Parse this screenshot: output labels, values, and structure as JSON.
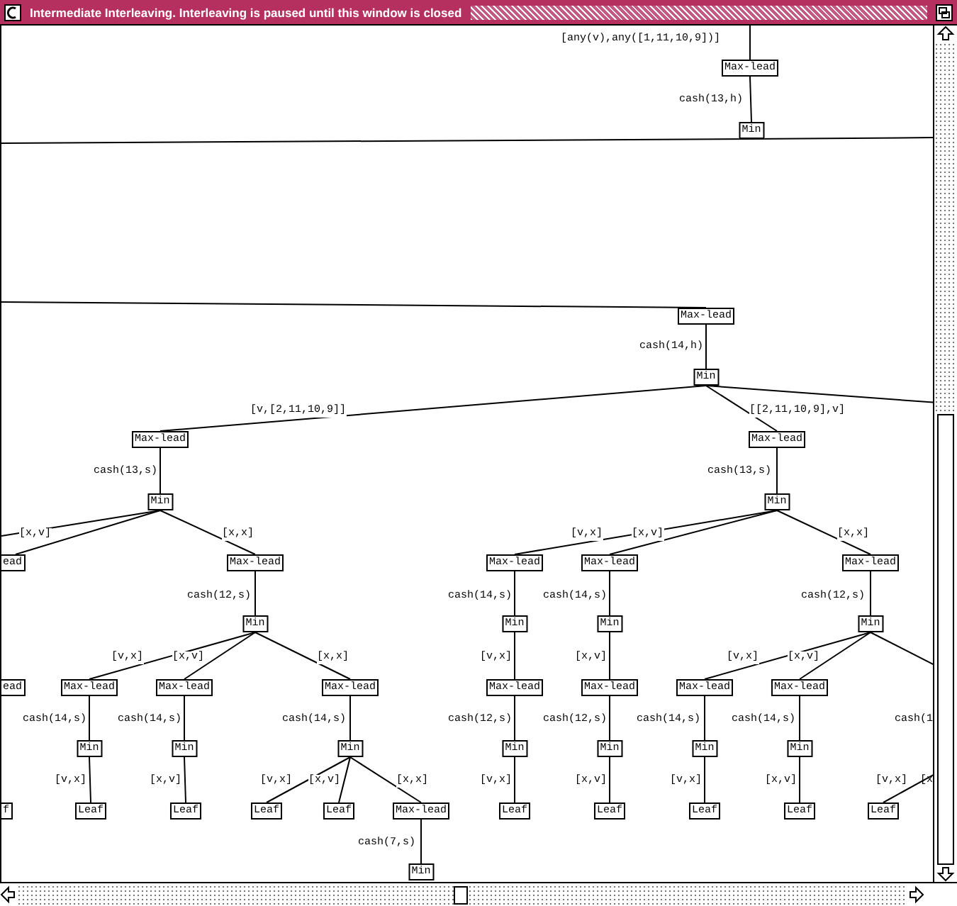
{
  "window": {
    "title": "Intermediate Interleaving. Interleaving is paused until this window is closed"
  },
  "trees": [
    {
      "label": "Max-lead",
      "edge": "[any(v),any([1,11,10,9])]",
      "children": [
        {
          "label": "Min",
          "edge": "cash(13,h)"
        }
      ]
    },
    {
      "label": "Max-lead",
      "children": [
        {
          "label": "Min",
          "edge": "cash(14,h)",
          "children": [
            {
              "label": "Max-lead",
              "edge": "[v,[2,11,10,9]]",
              "children": [
                {
                  "label": "Min",
                  "edge": "cash(13,s)",
                  "children": [
                    {
                      "label": "ead",
                      "edge": "[x,v]"
                    },
                    {
                      "label": "Max-lead",
                      "edge": "[x,x]",
                      "children": [
                        {
                          "label": "Min",
                          "edge": "cash(12,s)",
                          "children": [
                            {
                              "label": "Max-lead",
                              "edge": "[v,x]",
                              "children": [
                                {
                                  "label": "Min",
                                  "edge": "cash(14,s)",
                                  "children": [
                                    {
                                      "label": "Leaf",
                                      "edge": "[v,x]"
                                    }
                                  ]
                                }
                              ]
                            },
                            {
                              "label": "Max-lead",
                              "edge": "[x,v]",
                              "children": [
                                {
                                  "label": "Min",
                                  "edge": "cash(14,s)",
                                  "children": [
                                    {
                                      "label": "Leaf",
                                      "edge": "[x,v]"
                                    }
                                  ]
                                }
                              ]
                            },
                            {
                              "label": "Max-lead",
                              "edge": "[x,x]",
                              "children": [
                                {
                                  "label": "Min",
                                  "edge": "cash(14,s)",
                                  "children": [
                                    {
                                      "label": "Leaf",
                                      "edge": "[v,x]"
                                    },
                                    {
                                      "label": "Leaf",
                                      "edge": "[x,v]"
                                    },
                                    {
                                      "label": "Max-lead",
                                      "edge": "[x,x]",
                                      "children": [
                                        {
                                          "label": "Min",
                                          "edge": "cash(7,s)"
                                        }
                                      ]
                                    }
                                  ]
                                }
                              ]
                            }
                          ]
                        }
                      ]
                    }
                  ]
                }
              ]
            },
            {
              "label": "Max-lead",
              "edge": "[[2,11,10,9],v]",
              "children": [
                {
                  "label": "Min",
                  "edge": "cash(13,s)",
                  "children": [
                    {
                      "label": "Max-lead",
                      "edge": "[v,x]",
                      "children": [
                        {
                          "label": "Min",
                          "edge": "cash(14,s)",
                          "children": [
                            {
                              "label": "Max-lead",
                              "edge": "[v,x]",
                              "children": [
                                {
                                  "label": "Min",
                                  "edge": "cash(12,s)",
                                  "children": [
                                    {
                                      "label": "Leaf",
                                      "edge": "[v,x]"
                                    }
                                  ]
                                }
                              ]
                            }
                          ]
                        }
                      ]
                    },
                    {
                      "label": "Max-lead",
                      "edge": "[x,v]",
                      "children": [
                        {
                          "label": "Min",
                          "edge": "cash(14,s)",
                          "children": [
                            {
                              "label": "Max-lead",
                              "edge": "[x,v]",
                              "children": [
                                {
                                  "label": "Min",
                                  "edge": "cash(12,s)",
                                  "children": [
                                    {
                                      "label": "Leaf",
                                      "edge": "[x,v]"
                                    }
                                  ]
                                }
                              ]
                            }
                          ]
                        }
                      ]
                    },
                    {
                      "label": "Max-lead",
                      "edge": "[x,x]",
                      "children": [
                        {
                          "label": "Min",
                          "edge": "cash(12,s)",
                          "children": [
                            {
                              "label": "Max-lead",
                              "edge": "[v,x]",
                              "children": [
                                {
                                  "label": "Min",
                                  "edge": "cash(14,s)",
                                  "children": [
                                    {
                                      "label": "Leaf",
                                      "edge": "[v,x]"
                                    }
                                  ]
                                }
                              ]
                            },
                            {
                              "label": "Max-lead",
                              "edge": "[x,v]",
                              "children": [
                                {
                                  "label": "Min",
                                  "edge": "cash(14,s)",
                                  "children": [
                                    {
                                      "label": "Leaf",
                                      "edge": "[x,v]"
                                    }
                                  ]
                                }
                              ]
                            }
                          ]
                        }
                      ]
                    }
                  ]
                }
              ]
            }
          ]
        }
      ]
    },
    {
      "label": "ead"
    },
    {
      "label": "f"
    },
    {
      "label": "Leaf",
      "edge": "[v,x]"
    }
  ],
  "clipped_texts": [
    "cash(1",
    "[x"
  ]
}
